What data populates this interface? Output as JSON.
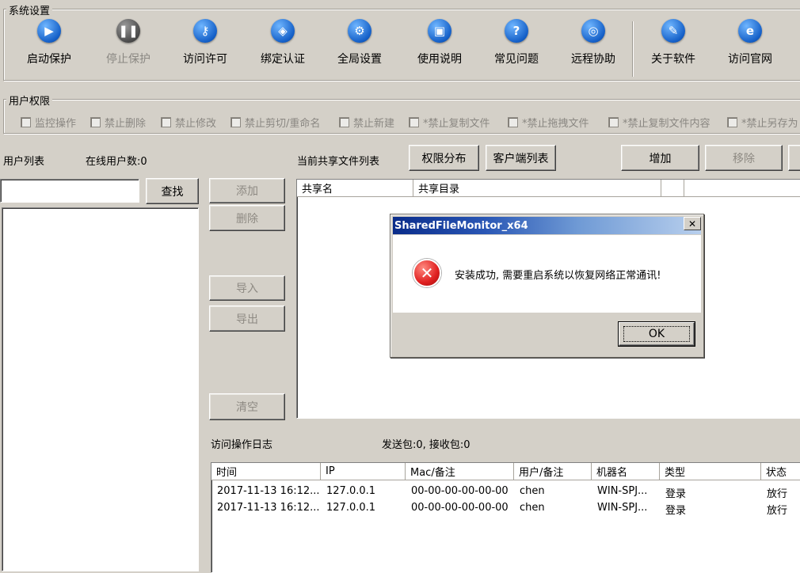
{
  "system_settings": {
    "title": "系统设置",
    "buttons": [
      {
        "label": "启动保护",
        "icon": "play-icon",
        "glyph": "▶",
        "enabled": true
      },
      {
        "label": "停止保护",
        "icon": "pause-icon",
        "glyph": "❚❚",
        "enabled": false
      },
      {
        "label": "访问许可",
        "icon": "key-icon",
        "glyph": "⚷",
        "enabled": true
      },
      {
        "label": "绑定认证",
        "icon": "shield-icon",
        "glyph": "◈",
        "enabled": true
      },
      {
        "label": "全局设置",
        "icon": "gear-icon",
        "glyph": "⚙",
        "enabled": true
      },
      {
        "label": "使用说明",
        "icon": "book-icon",
        "glyph": "▣",
        "enabled": true
      },
      {
        "label": "常见问题",
        "icon": "question-icon",
        "glyph": "?",
        "enabled": true
      },
      {
        "label": "远程协助",
        "icon": "globe-icon",
        "glyph": "◎",
        "enabled": true
      },
      {
        "label": "关于软件",
        "icon": "document-icon",
        "glyph": "✎",
        "enabled": true
      },
      {
        "label": "访问官网",
        "icon": "ie-icon",
        "glyph": "e",
        "enabled": true
      }
    ]
  },
  "user_permissions": {
    "title": "用户权限",
    "options": [
      "监控操作",
      "禁止删除",
      "禁止修改",
      "禁止剪切/重命名",
      "禁止新建",
      "*禁止复制文件",
      "*禁止拖拽文件",
      "*禁止复制文件内容",
      "*禁止另存为"
    ]
  },
  "user_list": {
    "label": "用户列表",
    "online_label": "在线用户数:0",
    "search_value": "",
    "search_button": "查找"
  },
  "middle_buttons": {
    "add": "添加",
    "delete": "删除",
    "import": "导入",
    "export": "导出",
    "clear": "清空"
  },
  "shared_files": {
    "label": "当前共享文件列表",
    "perm_button": "权限分布",
    "client_button": "客户端列表",
    "add_button": "增加",
    "remove_button": "移除",
    "columns": [
      "共享名",
      "共享目录"
    ]
  },
  "log": {
    "label": "访问操作日志",
    "packets": "发送包:0, 接收包:0",
    "columns": [
      "时间",
      "IP",
      "Mac/备注",
      "用户/备注",
      "机器名",
      "类型",
      "状态"
    ],
    "rows": [
      [
        "2017-11-13 16:12...",
        "127.0.0.1",
        "00-00-00-00-00-00",
        "chen",
        "WIN-SPJ...",
        "登录",
        "放行"
      ],
      [
        "2017-11-13 16:12...",
        "127.0.0.1",
        "00-00-00-00-00-00",
        "chen",
        "WIN-SPJ...",
        "登录",
        "放行"
      ]
    ]
  },
  "dialog": {
    "title": "SharedFileMonitor_x64",
    "close": "✕",
    "message": "安装成功, 需要重启系统以恢复网络正常通讯!",
    "ok": "OK",
    "icon": "error-icon"
  }
}
